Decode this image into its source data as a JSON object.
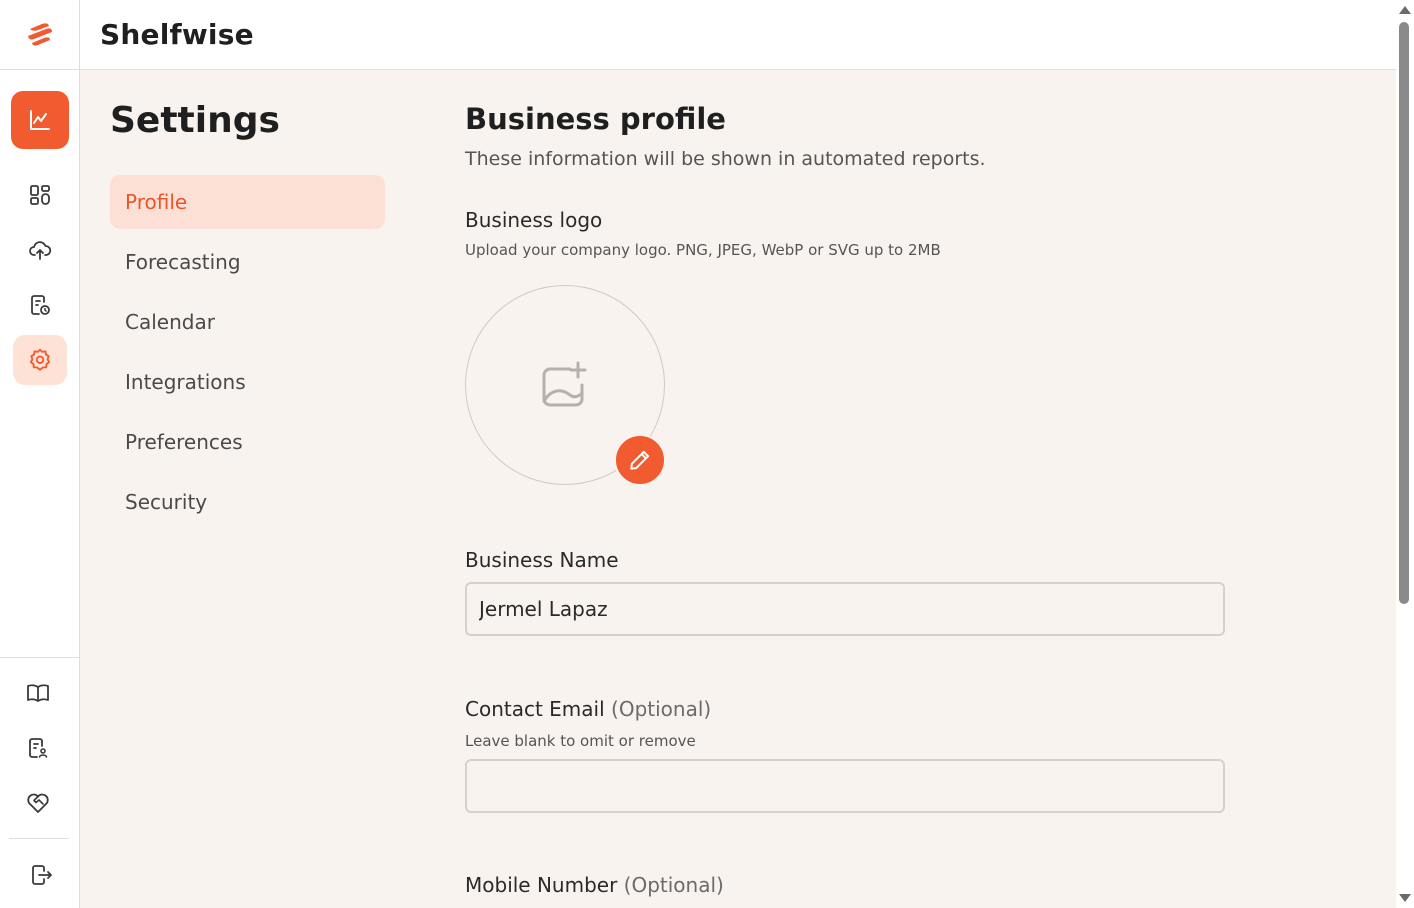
{
  "app": {
    "name": "Shelfwise",
    "brand_color": "#f25a2f"
  },
  "rail": {
    "top_items": [
      {
        "icon": "chart-icon",
        "active": "primary"
      },
      {
        "icon": "dashboard-grid-icon"
      },
      {
        "icon": "cloud-upload-icon"
      },
      {
        "icon": "report-clock-icon"
      },
      {
        "icon": "gear-icon",
        "active": "current"
      }
    ],
    "bottom_items": [
      {
        "icon": "book-icon"
      },
      {
        "icon": "document-user-icon"
      },
      {
        "icon": "heart-handshake-icon"
      },
      {
        "icon": "logout-icon"
      }
    ]
  },
  "settings": {
    "title": "Settings",
    "nav": [
      "Profile",
      "Forecasting",
      "Calendar",
      "Integrations",
      "Preferences",
      "Security"
    ],
    "active_nav": "Profile"
  },
  "profile": {
    "title": "Business profile",
    "subtitle": "These information will be shown in automated reports.",
    "logo_label": "Business logo",
    "logo_hint": "Upload your company logo. PNG, JPEG, WebP or SVG up to 2MB",
    "business_name_label": "Business Name",
    "business_name_value": "Jermel Lapaz",
    "contact_email_label": "Contact Email",
    "contact_email_optional": "(Optional)",
    "contact_email_hint": "Leave blank to omit or remove",
    "contact_email_value": "",
    "mobile_label": "Mobile Number",
    "mobile_optional": "(Optional)"
  }
}
